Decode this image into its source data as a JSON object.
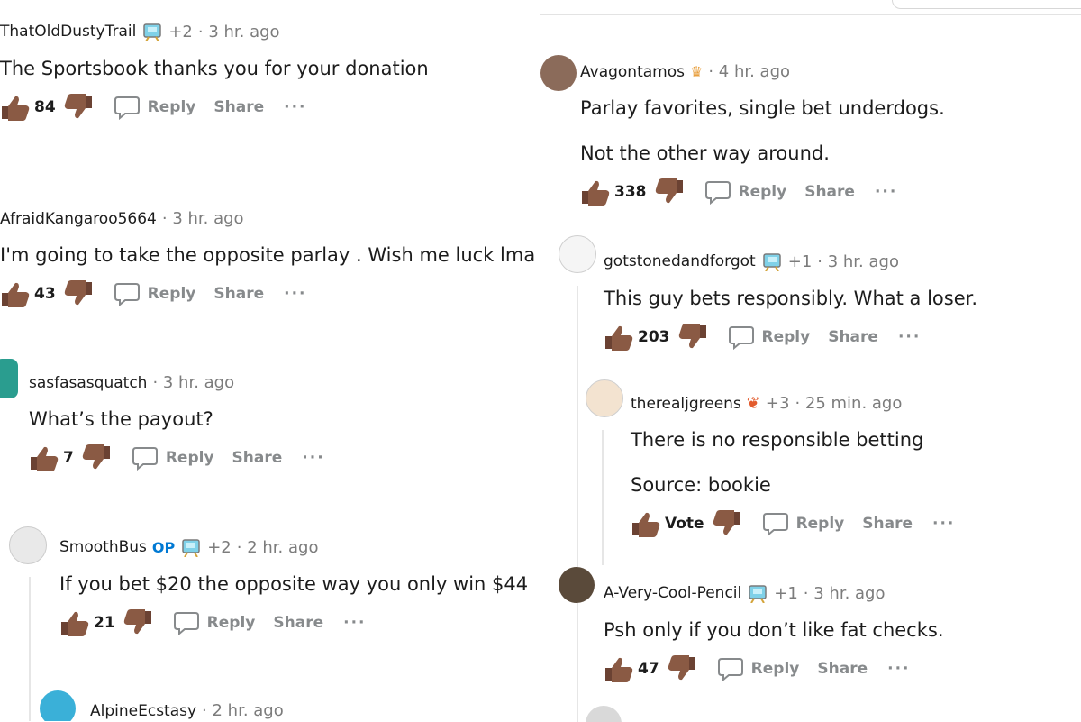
{
  "left": {
    "c1": {
      "user": "ThatOldDustyTrail",
      "plus": "+2",
      "time": "· 3 hr. ago",
      "text": "The Sportsbook thanks you for your donation",
      "votes": "84"
    },
    "c2": {
      "user": "AfraidKangaroo5664",
      "time": "· 3 hr. ago",
      "text": "I'm going to take the opposite parlay . Wish me luck lma",
      "votes": "43"
    },
    "c3": {
      "user": "sasfasasquatch",
      "time": "· 3 hr. ago",
      "text": "What’s the payout?",
      "votes": "7"
    },
    "c4": {
      "user": "SmoothBus",
      "op": "OP",
      "plus": "+2",
      "time": "· 2 hr. ago",
      "text": "If you bet $20 the opposite way you only win $44",
      "votes": "21"
    },
    "c5": {
      "user": "AlpineEcstasy",
      "time": "· 2 hr. ago"
    }
  },
  "right": {
    "c1": {
      "user": "Avagontamos",
      "time": "· 4 hr. ago",
      "text1": "Parlay favorites, single bet underdogs.",
      "text2": "Not the other way around.",
      "votes": "338"
    },
    "c2": {
      "user": "gotstonedandforgot",
      "plus": "+1",
      "time": "· 3 hr. ago",
      "text": "This guy bets responsibly. What a loser.",
      "votes": "203"
    },
    "c3": {
      "user": "therealjgreens",
      "plus": "+3",
      "time": "· 25 min. ago",
      "text1": "There is no responsible betting",
      "text2": "Source: bookie",
      "votes": "Vote"
    },
    "c4": {
      "user": "A-Very-Cool-Pencil",
      "plus": "+1",
      "time": "· 3 hr. ago",
      "text": "Psh only if you don’t like fat checks.",
      "votes": "47"
    }
  },
  "labels": {
    "reply": "Reply",
    "share": "Share",
    "more": "···"
  },
  "icons": [
    "thumbs-up-icon",
    "thumbs-down-icon",
    "reply-bubble-icon",
    "award-icon",
    "avatar"
  ],
  "colors": {
    "meta": "#7c7c7c",
    "action": "#878a8c",
    "op": "#0079d3",
    "thumb": "#8a5a44"
  }
}
